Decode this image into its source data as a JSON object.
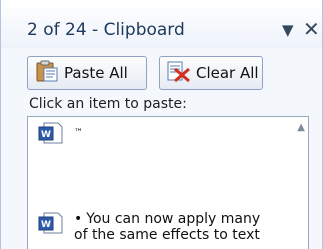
{
  "titlebar": {
    "title": "2 of 24 - Clipboard",
    "dropdown_icon": "dropdown-arrow-icon",
    "close_icon": "close-icon"
  },
  "toolbar": {
    "paste_all_label": "Paste All",
    "clear_all_label": "Clear All"
  },
  "instruction": "Click an item to paste:",
  "items": [
    {
      "text": "™",
      "icon": "word-document-icon"
    },
    {
      "bullet": "•",
      "text": "You can now apply many of the same effects to text",
      "icon": "word-document-icon"
    }
  ],
  "colors": {
    "title_text": "#1e395b",
    "pane_background": "#f4f7fc",
    "border": "#9aa9c3"
  }
}
